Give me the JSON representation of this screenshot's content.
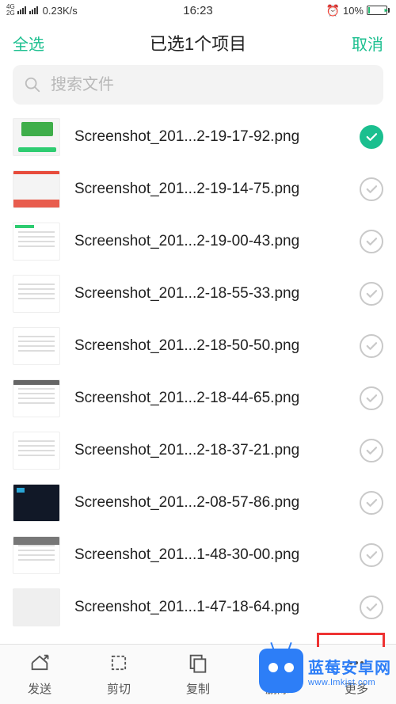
{
  "status": {
    "net_label_top": "4G",
    "net_label_bot": "2G",
    "speed": "0.23K/s",
    "time": "16:23",
    "alarm_icon": "⏰",
    "battery_pct": "10%"
  },
  "nav": {
    "select_all": "全选",
    "title": "已选1个项目",
    "cancel": "取消"
  },
  "search": {
    "placeholder": "搜索文件"
  },
  "files": [
    {
      "name": "Screenshot_201...2-19-17-92.png",
      "selected": true,
      "thumb": "th-green"
    },
    {
      "name": "Screenshot_201...2-19-14-75.png",
      "selected": false,
      "thumb": "th-redbar"
    },
    {
      "name": "Screenshot_201...2-19-00-43.png",
      "selected": false,
      "thumb": "th-leftgreen th-lines"
    },
    {
      "name": "Screenshot_201...2-18-55-33.png",
      "selected": false,
      "thumb": "th-lines"
    },
    {
      "name": "Screenshot_201...2-18-50-50.png",
      "selected": false,
      "thumb": "th-lines"
    },
    {
      "name": "Screenshot_201...2-18-44-65.png",
      "selected": false,
      "thumb": "th-topbar th-lines"
    },
    {
      "name": "Screenshot_201...2-18-37-21.png",
      "selected": false,
      "thumb": "th-lines"
    },
    {
      "name": "Screenshot_201...2-08-57-86.png",
      "selected": false,
      "thumb": "th-dark"
    },
    {
      "name": "Screenshot_201...1-48-30-00.png",
      "selected": false,
      "thumb": "th-graytop th-lines"
    },
    {
      "name": "Screenshot_201...1-47-18-64.png",
      "selected": false,
      "thumb": "th-plain"
    }
  ],
  "toolbar": {
    "send": "发送",
    "cut": "剪切",
    "copy": "复制",
    "delete": "删除",
    "more": "更多"
  },
  "watermark": {
    "line1": "蓝莓安卓网",
    "line2": "www.lmkjst.com"
  }
}
